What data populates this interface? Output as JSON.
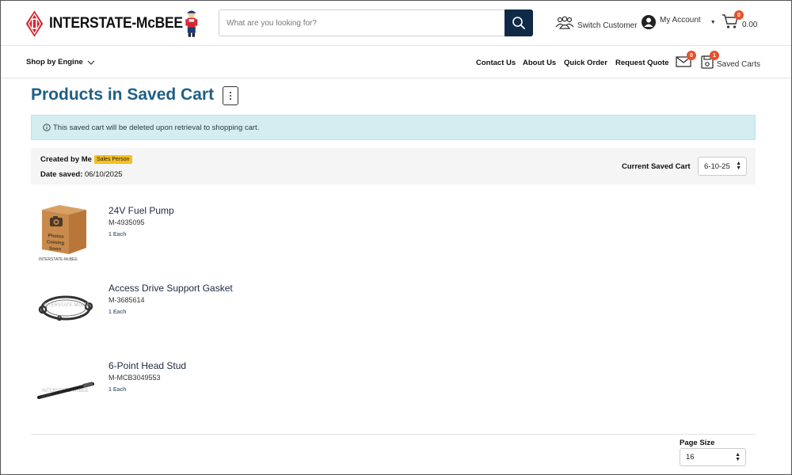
{
  "header": {
    "brand": "INTERSTATE-McBEE",
    "search_placeholder": "What are you looking for?",
    "switch_customer": "Switch Customer",
    "my_account": "My Account",
    "cart_count": "0",
    "cart_total": "0.00"
  },
  "nav": {
    "shop_by_engine": "Shop by Engine",
    "links": [
      "Contact Us",
      "About Us",
      "Quick Order",
      "Request Quote"
    ],
    "messages_count": "0",
    "saved_carts_count": "1",
    "saved_carts": "Saved Carts"
  },
  "main": {
    "title": "Products in Saved Cart",
    "alert": "This saved cart will be deleted upon retrieval to shopping cart.",
    "created_by_label": "Created by Me",
    "created_by_badge": "Sales Person",
    "date_saved_label": "Date saved:",
    "date_saved_value": "06/10/2025",
    "current_saved_cart_label": "Current Saved Cart",
    "current_saved_cart_value": "6-10-25",
    "items": [
      {
        "name": "24V Fuel Pump",
        "sku": "M-4935095",
        "qty": "1 Each",
        "image_caption": "Photos Coming Soon",
        "image_brand": "INTERSTATE-McBEE"
      },
      {
        "name": "Access Drive Support Gasket",
        "sku": "M-3685614",
        "qty": "1 Each"
      },
      {
        "name": "6-Point Head Stud",
        "sku": "M-MCB3049553",
        "qty": "1 Each"
      }
    ],
    "page_size_label": "Page Size",
    "page_size_value": "16"
  },
  "colors": {
    "brand_red": "#d3262e",
    "title_blue": "#1e5f86",
    "search_button": "#0f2a46",
    "badge_orange": "#e8502a",
    "alert_bg": "#d4edf1",
    "sales_badge": "#f5c020"
  }
}
